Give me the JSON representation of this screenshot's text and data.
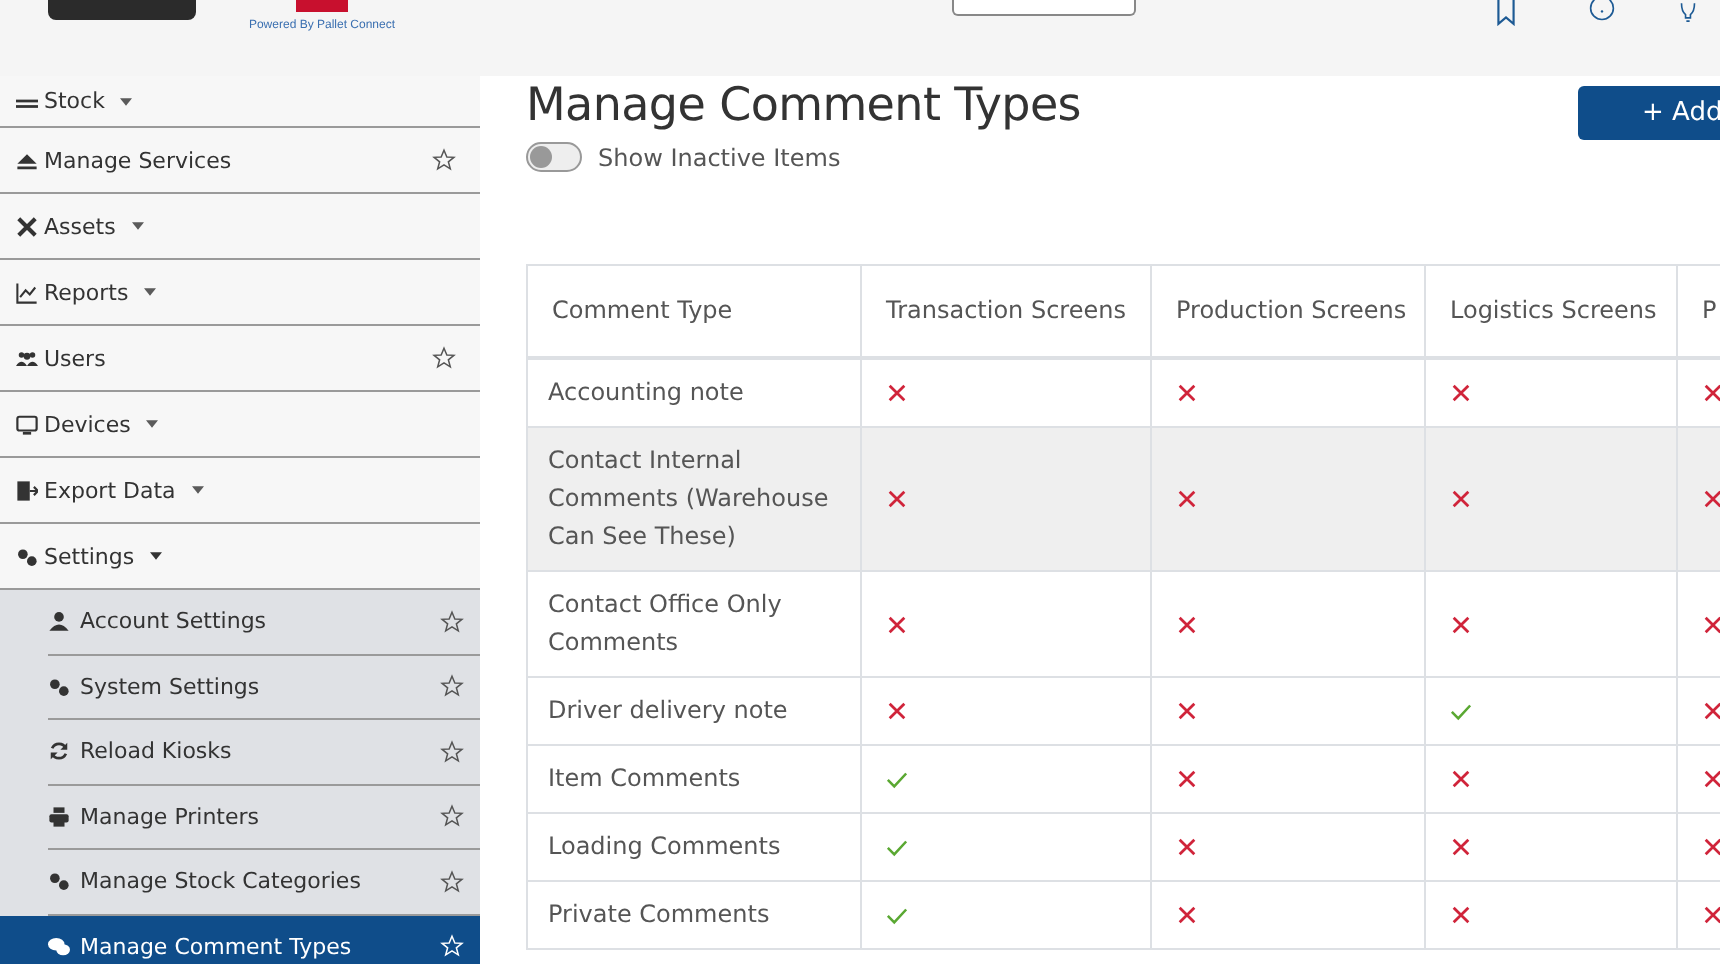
{
  "header": {
    "powered_by": "Powered By Pallet Connect"
  },
  "sidebar": {
    "items": [
      {
        "label": "Stock",
        "kind": "menu",
        "expanded": false
      },
      {
        "label": "Manage Services",
        "kind": "link",
        "selected": false
      },
      {
        "label": "Assets",
        "kind": "menu",
        "expanded": false
      },
      {
        "label": "Reports",
        "kind": "menu",
        "expanded": false
      },
      {
        "label": "Users",
        "kind": "link",
        "selected": false
      },
      {
        "label": "Devices",
        "kind": "menu",
        "expanded": false
      },
      {
        "label": "Export Data",
        "kind": "menu",
        "expanded": false
      },
      {
        "label": "Settings",
        "kind": "menu",
        "expanded": true,
        "children": [
          {
            "label": "Account Settings",
            "selected": false
          },
          {
            "label": "System Settings",
            "selected": false
          },
          {
            "label": "Reload Kiosks",
            "selected": false
          },
          {
            "label": "Manage Printers",
            "selected": false
          },
          {
            "label": "Manage Stock Categories",
            "selected": false
          },
          {
            "label": "Manage Comment Types",
            "selected": true
          }
        ]
      }
    ]
  },
  "page": {
    "title": "Manage Comment Types",
    "add_button": "+ Add",
    "toggle": {
      "label": "Show Inactive Items",
      "on": false
    }
  },
  "table": {
    "columns": [
      "Comment Type",
      "Transaction Screens",
      "Production Screens",
      "Logistics Screens",
      "P"
    ],
    "rows": [
      {
        "name": "Accounting note",
        "screens": [
          false,
          false,
          false,
          false
        ],
        "highlighted": false
      },
      {
        "name": "Contact Internal Comments (Warehouse Can See These)",
        "screens": [
          false,
          false,
          false,
          false
        ],
        "highlighted": true
      },
      {
        "name": "Contact Office Only Comments",
        "screens": [
          false,
          false,
          false,
          false
        ],
        "highlighted": false
      },
      {
        "name": "Driver delivery note",
        "screens": [
          false,
          false,
          true,
          false
        ],
        "highlighted": false
      },
      {
        "name": "Item Comments",
        "screens": [
          true,
          false,
          false,
          false
        ],
        "highlighted": false
      },
      {
        "name": "Loading Comments",
        "screens": [
          true,
          false,
          false,
          false
        ],
        "highlighted": false
      },
      {
        "name": "Private Comments",
        "screens": [
          true,
          false,
          false,
          false
        ],
        "highlighted": false
      }
    ]
  }
}
